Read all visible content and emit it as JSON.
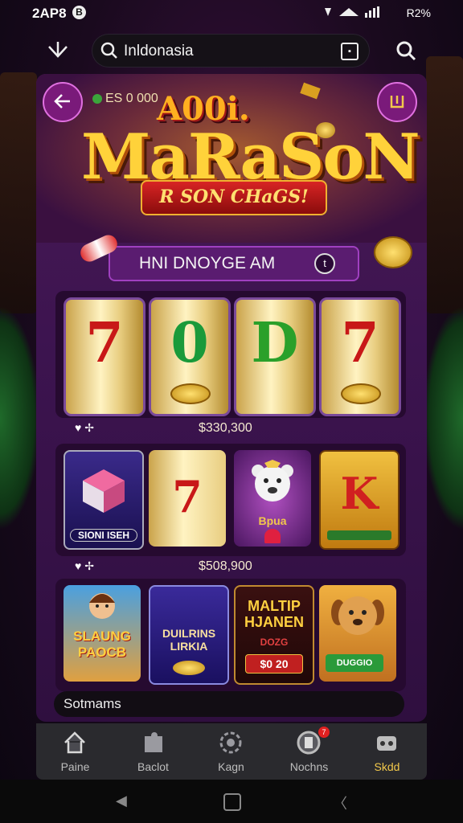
{
  "status_bar": {
    "time": "2AP8",
    "notification_icon": "B",
    "battery_text": "R2%"
  },
  "search": {
    "value": "Inldonasia"
  },
  "header": {
    "balance": "ES 0 000"
  },
  "banner": {
    "title_top": "A00i.",
    "title_main": "MaRaSoN",
    "ribbon": "R SON CHaGS!"
  },
  "slot": {
    "title": "HNI DNOYGE AM",
    "title_badge": "t",
    "reels": [
      "7",
      "0",
      "D",
      "7"
    ],
    "reel_colors": [
      "#c81818",
      "#1a9a3a",
      "#2aa02a",
      "#c81818"
    ]
  },
  "rows": [
    {
      "hearts": "♥ ✢",
      "amount": "$330,300"
    },
    {
      "hearts": "♥ ✢",
      "amount": "$508,900"
    }
  ],
  "tiles_row1": [
    {
      "label": "SIONI ISEH",
      "kind": "cube"
    },
    {
      "big": "7",
      "kind": "seven"
    },
    {
      "label": "Bpua",
      "kind": "bear"
    },
    {
      "big": "K",
      "kind": "k"
    }
  ],
  "tiles_row2": [
    {
      "name": "SLAUNG PAOCB",
      "kind": "girl"
    },
    {
      "name": "DUILRINS LIRKIA",
      "kind": "swords"
    },
    {
      "name": "MALTIP HJANEN",
      "sub": "DOZG",
      "pill": "$0 20",
      "kind": "text"
    },
    {
      "label": "DUGGIO",
      "kind": "dog"
    }
  ],
  "bottom_input": {
    "value": "Sotmams"
  },
  "nav": [
    {
      "label": "Paine",
      "icon": "home-icon"
    },
    {
      "label": "Baclot",
      "icon": "puzzle-icon"
    },
    {
      "label": "Kagn",
      "icon": "settings-icon"
    },
    {
      "label": "Nochns",
      "icon": "notification-icon",
      "badge": "7"
    },
    {
      "label": "Skdd",
      "icon": "game-icon",
      "active": true
    }
  ],
  "colors": {
    "accent": "#f2c84b",
    "panel": "#4a1a55",
    "active_nav": "#f2c84b"
  }
}
